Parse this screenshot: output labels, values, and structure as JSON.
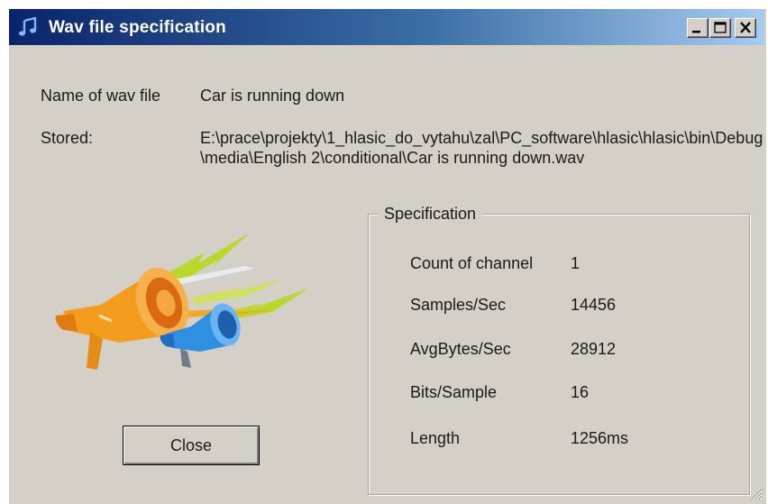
{
  "window": {
    "title": "Wav file specification",
    "icon": "music-note-icon",
    "controls": [
      "minimize-icon",
      "maximize-icon",
      "close-icon"
    ]
  },
  "file": {
    "name_label": "Name of wav file",
    "name_value": "Car is running down",
    "stored_label": "Stored:",
    "stored_value": "E:\\prace\\projekty\\1_hlasic_do_vytahu\\zal\\PC_software\\hlasic\\hlasic\\bin\\Debug\\media\\English 2\\conditional\\Car is running down.wav"
  },
  "specification": {
    "title": "Specification",
    "rows": [
      {
        "label": "Count of channel",
        "value": "1"
      },
      {
        "label": "Samples/Sec",
        "value": "14456"
      },
      {
        "label": "AvgBytes/Sec",
        "value": "28912"
      },
      {
        "label": "Bits/Sample",
        "value": "16"
      },
      {
        "label": "Length",
        "value": "1256ms"
      }
    ]
  },
  "buttons": {
    "close_label": "Close"
  },
  "illustration": {
    "icon": "megaphone-icon"
  }
}
